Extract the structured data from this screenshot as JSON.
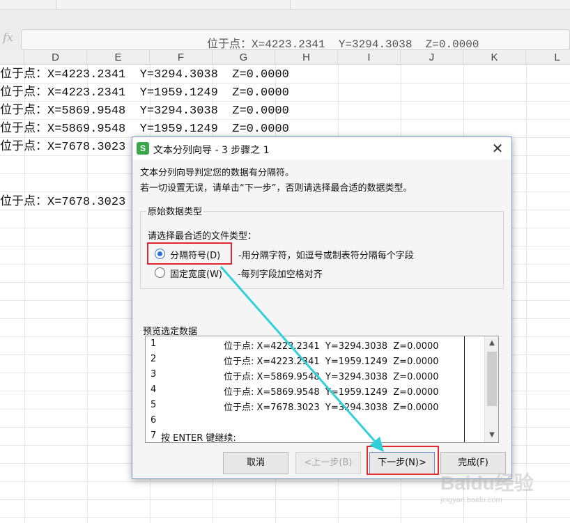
{
  "formula_bar": {
    "fx_label": "fx",
    "value_prefix": "位于点：",
    "value_rest": "X=4223.2341  Y=3294.3038  Z=0.0000"
  },
  "columns": [
    "D",
    "E",
    "F",
    "G",
    "H",
    "I",
    "J",
    "K",
    "L"
  ],
  "cells": [
    {
      "prefix": "位于点：",
      "coords": "X=4223.2341  Y=3294.3038  Z=0.0000"
    },
    {
      "prefix": "位于点：",
      "coords": "X=4223.2341  Y=1959.1249  Z=0.0000"
    },
    {
      "prefix": "位于点：",
      "coords": "X=5869.9548  Y=3294.3038  Z=0.0000"
    },
    {
      "prefix": "位于点：",
      "coords": "X=5869.9548  Y=1959.1249  Z=0.0000"
    },
    {
      "prefix": "位于点：",
      "coords": "X=7678.3023"
    },
    {
      "prefix": "位于点：",
      "coords": "X=7678.3023"
    }
  ],
  "dialog": {
    "title": "文本分列向导 - 3 步骤之 1",
    "app_icon_letter": "S",
    "close_symbol": "✕",
    "description_line1": "文本分列向导判定您的数据有分隔符。",
    "description_line2": "若一切设置无误，请单击“下一步”，否则请选择最合适的数据类型。",
    "group_title": "原始数据类型",
    "choose_label": "请选择最合适的文件类型：",
    "options": [
      {
        "label": "分隔符号(D)",
        "hint": "-用分隔字符，如逗号或制表符分隔每个字段",
        "checked": true
      },
      {
        "label": "固定宽度(W)",
        "hint": "-每列字段加空格对齐",
        "checked": false
      }
    ],
    "preview_title": "预览选定数据",
    "preview_rows": [
      {
        "num": "1",
        "text": "位于点: X=4223.2341  Y=3294.3038  Z=0.0000"
      },
      {
        "num": "2",
        "text": "位于点: X=4223.2341  Y=1959.1249  Z=0.0000"
      },
      {
        "num": "3",
        "text": "位于点: X=5869.9548  Y=3294.3038  Z=0.0000"
      },
      {
        "num": "4",
        "text": "位于点: X=5869.9548  Y=1959.1249  Z=0.0000"
      },
      {
        "num": "5",
        "text": "位于点: X=7678.3023  Y=3294.3038  Z=0.0000"
      },
      {
        "num": "6",
        "text": ""
      },
      {
        "num": "7",
        "text": "按 ENTER 键继续:"
      }
    ],
    "buttons": {
      "cancel": "取消",
      "back": "<上一步(B)",
      "next": "下一步(N)>",
      "finish": "完成(F)"
    }
  },
  "watermark": {
    "main": "Baidu经验",
    "sub": "jingyan.baidu.com"
  },
  "colors": {
    "highlight": "#e0282e",
    "arrow": "#2fd0d8",
    "radio_accent": "#2e72d8"
  }
}
